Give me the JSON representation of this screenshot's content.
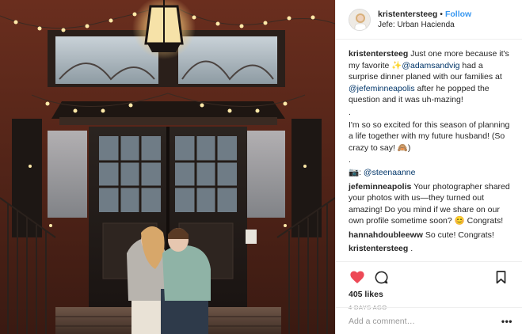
{
  "header": {
    "username": "kristentersteeg",
    "separator": "•",
    "follow_label": "Follow",
    "location": "Jefe: Urban Hacienda"
  },
  "caption": {
    "user": "kristentersteeg",
    "part1": " Just one more because it's my favorite ",
    "sparkle": "✨",
    "mention1": "@adamsandvig",
    "part2": " had a surprise dinner planed with our families at ",
    "mention2": "@jefeminneapolis",
    "part3": " after he popped the question and it was uh-mazing!",
    "dot1": ".",
    "para2": "I'm so so excited for this season of planning a life together with my future husband! (So crazy to say! 🙈)",
    "dot2": ".",
    "camera": "📷",
    "credit_prefix": ": ",
    "credit_mention": "@steenaanne"
  },
  "comments": [
    {
      "user": "jefeminneapolis",
      "text": " Your photographer shared your photos with us—they turned out amazing! Do you mind if we share on our own profile sometime soon? 😊 Congrats!"
    },
    {
      "user": "hannahdoubleeww",
      "text": " So cute! Congrats!"
    },
    {
      "user": "kristentersteeg",
      "text": " ."
    }
  ],
  "trailing_dots": [
    ".",
    "."
  ],
  "actions": {
    "like_icon": "heart-icon",
    "comment_icon": "comment-icon",
    "save_icon": "bookmark-icon",
    "liked_color": "#ed4956"
  },
  "likes_text": "405 likes",
  "date_text": "4 DAYS AGO",
  "add_comment": {
    "placeholder": "Add a comment…",
    "more_label": "•••"
  }
}
